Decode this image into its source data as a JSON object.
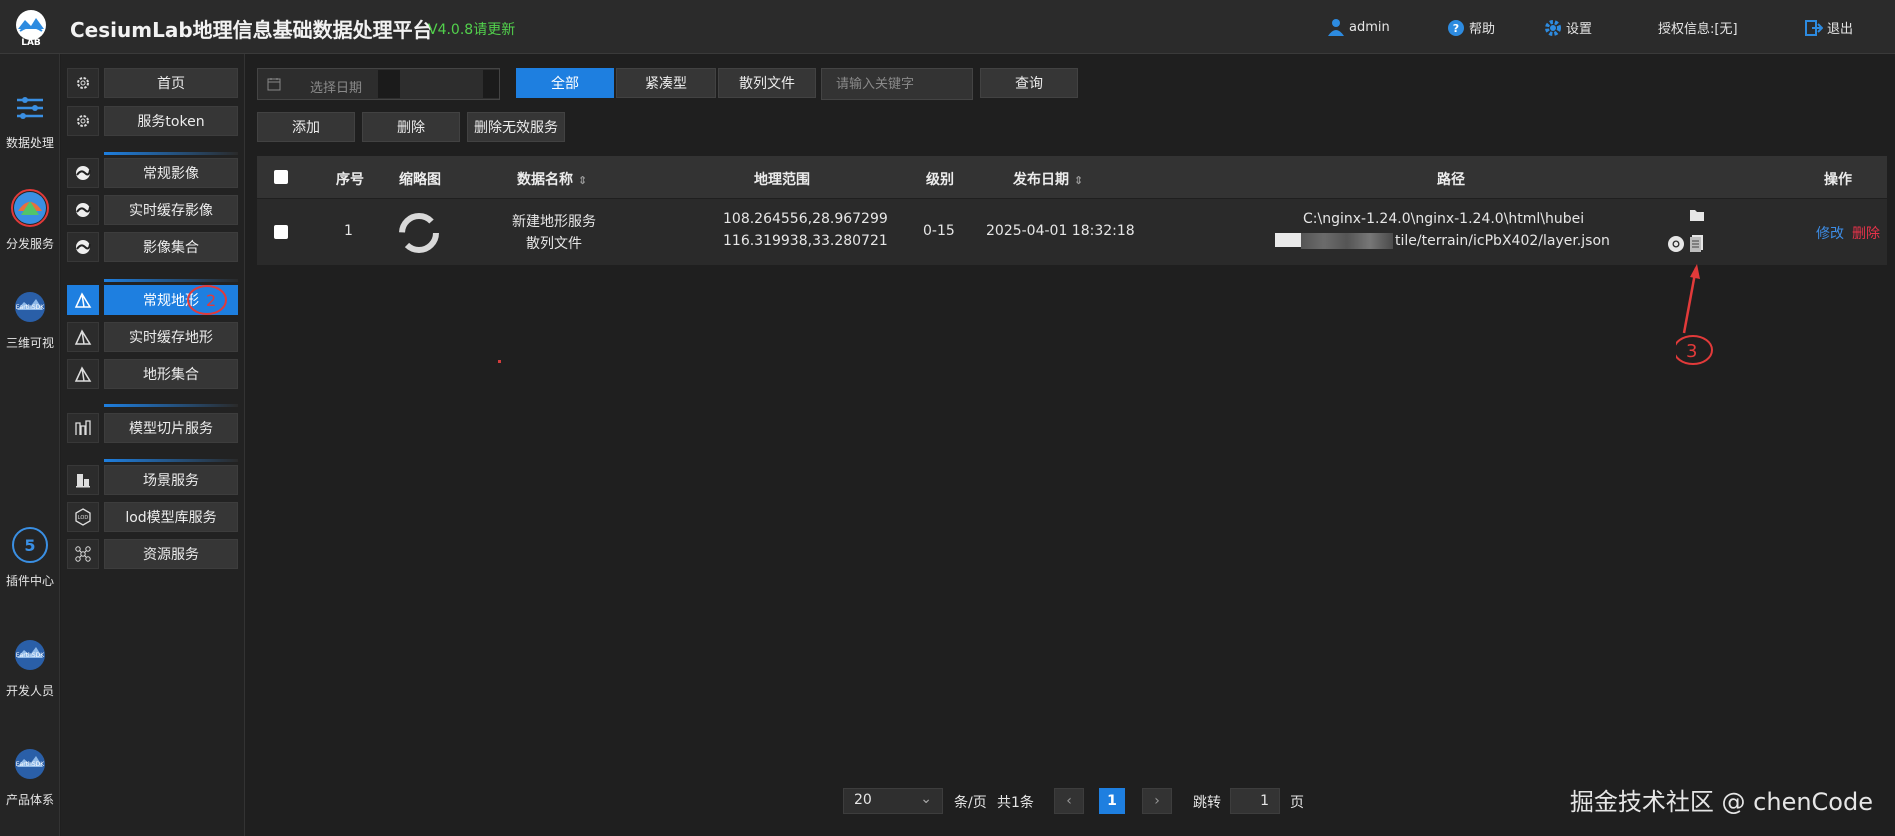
{
  "header": {
    "title": "CesiumLab地理信息基础数据处理平台",
    "version": "V4.0.8请更新",
    "logo_text": "LAB",
    "user": "admin",
    "help": "帮助",
    "settings": "设置",
    "license": "授权信息:[无]",
    "logout": "退出"
  },
  "rail": [
    {
      "label": "数据处理",
      "icon": "data-process-icon"
    },
    {
      "label": "分发服务",
      "icon": "distribute-service-icon"
    },
    {
      "label": "三维可视",
      "icon": "earthsdk-icon"
    },
    {
      "label": "插件中心",
      "icon": "plugin-center-icon"
    },
    {
      "label": "开发人员",
      "icon": "earthsdk-icon"
    },
    {
      "label": "产品体系",
      "icon": "earthsdk-icon"
    }
  ],
  "subnav": [
    {
      "label": "首页",
      "icon": "gear-icon"
    },
    {
      "label": "服务token",
      "icon": "gear-icon"
    },
    {
      "label": "常规影像",
      "icon": "globe-icon"
    },
    {
      "label": "实时缓存影像",
      "icon": "globe-icon"
    },
    {
      "label": "影像集合",
      "icon": "globe-icon"
    },
    {
      "label": "常规地形",
      "icon": "terrain-icon"
    },
    {
      "label": "实时缓存地形",
      "icon": "terrain-icon"
    },
    {
      "label": "地形集合",
      "icon": "terrain-icon"
    },
    {
      "label": "模型切片服务",
      "icon": "model-icon"
    },
    {
      "label": "场景服务",
      "icon": "scene-icon"
    },
    {
      "label": "lod模型库服务",
      "icon": "lod-icon"
    },
    {
      "label": "资源服务",
      "icon": "resource-icon"
    }
  ],
  "filter": {
    "date_placeholder": "选择日期",
    "tabs": [
      "全部",
      "紧凑型",
      "散列文件"
    ],
    "search_placeholder": "请输入关键字",
    "query": "查询"
  },
  "actions": [
    "添加",
    "删除",
    "删除无效服务"
  ],
  "table": {
    "headers": [
      "序号",
      "缩略图",
      "数据名称",
      "地理范围",
      "级别",
      "发布日期",
      "路径",
      "操作"
    ],
    "rows": [
      {
        "index": "1",
        "name_line1": "新建地形服务",
        "name_line2": "散列文件",
        "range_line1": "108.264556,28.967299",
        "range_line2": "116.319938,33.280721",
        "level": "0-15",
        "date": "2025-04-01 18:32:18",
        "path_line1": "C:\\nginx-1.24.0\\nginx-1.24.0\\html\\hubei",
        "path_line2": "tile/terrain/icPbX402/layer.json",
        "edit": "修改",
        "delete": "删除"
      }
    ]
  },
  "pagination": {
    "page_size": "20",
    "per_page_label": "条/页",
    "total": "共1条",
    "current": "1",
    "jump_label": "跳转",
    "jump_value": "1",
    "page_unit": "页"
  },
  "annotations": [
    "2",
    "3"
  ],
  "watermark": "掘金技术社区 @ chenCode",
  "colors": {
    "accent": "#1e7fe0",
    "danger": "#e8334a",
    "version": "#52d14c"
  }
}
